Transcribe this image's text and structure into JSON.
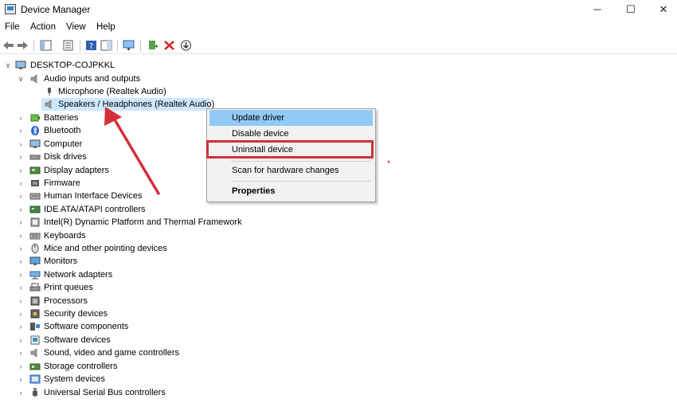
{
  "window": {
    "title": "Device Manager",
    "minimize": "─",
    "maximize": "☐",
    "close": "✕"
  },
  "menu": [
    "File",
    "Action",
    "View",
    "Help"
  ],
  "tree": {
    "root": "DESKTOP-COJPKKL",
    "audio": {
      "label": "Audio inputs and outputs",
      "children": [
        "Microphone (Realtek Audio)",
        "Speakers / Headphones (Realtek Audio)"
      ]
    },
    "categories": [
      "Batteries",
      "Bluetooth",
      "Computer",
      "Disk drives",
      "Display adapters",
      "Firmware",
      "Human Interface Devices",
      "IDE ATA/ATAPI controllers",
      "Intel(R) Dynamic Platform and Thermal Framework",
      "Keyboards",
      "Mice and other pointing devices",
      "Monitors",
      "Network adapters",
      "Print queues",
      "Processors",
      "Security devices",
      "Software components",
      "Software devices",
      "Sound, video and game controllers",
      "Storage controllers",
      "System devices",
      "Universal Serial Bus controllers"
    ]
  },
  "context_menu": {
    "update": "Update driver",
    "disable": "Disable device",
    "uninstall": "Uninstall device",
    "scan": "Scan for hardware changes",
    "properties": "Properties"
  },
  "colors": {
    "selection": "#cce8ff",
    "highlight": "#91c9f7",
    "annotation": "#d32f3a"
  }
}
